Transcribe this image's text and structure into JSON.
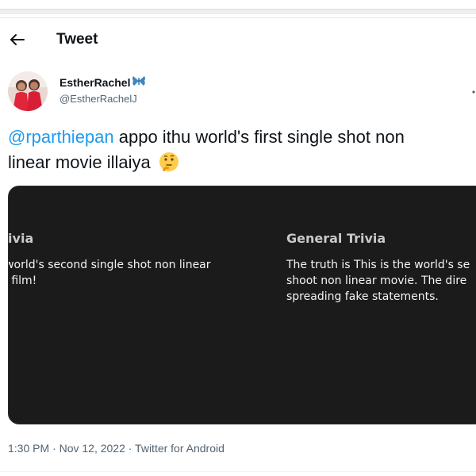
{
  "header": {
    "title": "Tweet"
  },
  "author": {
    "display_name": "EstherRachel",
    "username": "@EstherRachelJ"
  },
  "tweet": {
    "mention": "@rparthiepan",
    "text_line1": " appo ithu world's first single shot non",
    "text_line2": "linear movie illaiya"
  },
  "media": {
    "left": {
      "heading": " Trivia",
      "line1": "e world's second single shot non linear",
      "line2": "ay film!"
    },
    "right": {
      "heading": "General Trivia",
      "line1": "The truth is This is the world's se",
      "line2": "shoot non linear movie. The dire",
      "line3": "spreading fake statements."
    }
  },
  "meta": {
    "text": "1:30 PM · Nov 12, 2022 · Twitter for Android"
  },
  "colors": {
    "accent": "#1d9bf0",
    "media_bg": "#1b1b1b",
    "text_primary": "#0f1419",
    "text_secondary": "#536471"
  },
  "icons": {
    "back": "arrow-left-icon",
    "verified_badge": "butterfly-emoji-icon",
    "emoji": "thinking-face-icon",
    "more": "more-options-icon"
  }
}
